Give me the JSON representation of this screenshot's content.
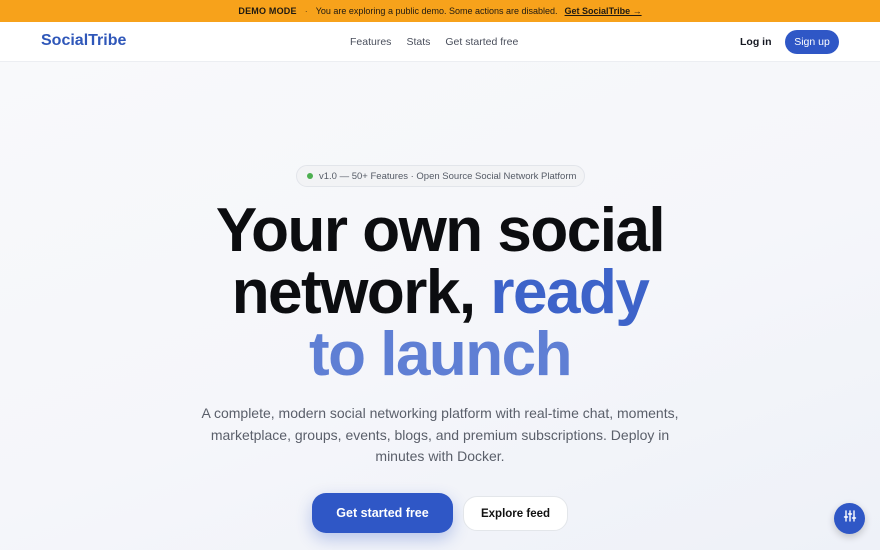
{
  "demo_banner": {
    "tag": "DEMO MODE",
    "separator": "·",
    "message": "You are exploring a public demo. Some actions are disabled.",
    "link": "Get SocialTribe →"
  },
  "nav": {
    "logo": "SocialTribe",
    "links": [
      "Features",
      "Stats",
      "Get started free"
    ],
    "login": "Log in",
    "signup": "Sign up"
  },
  "hero": {
    "pill": "v1.0 — 50+ Features · Open Source Social Network Platform",
    "headline_line1": "Your own social",
    "headline_line2_a": "network,",
    "headline_line2_b": "ready",
    "headline_line3": "to launch",
    "subtitle": "A complete, modern social networking platform with real-time chat, moments, marketplace, groups, events, blogs, and premium subscriptions. Deploy in minutes with Docker.",
    "primary_cta": "Get started free",
    "secondary_cta": "Explore feed"
  },
  "fab": {
    "icon": "sliders-icon"
  },
  "colors": {
    "accent": "#2f57c6",
    "banner": "#f7a21b",
    "headline_blue": "#3d63c9"
  }
}
